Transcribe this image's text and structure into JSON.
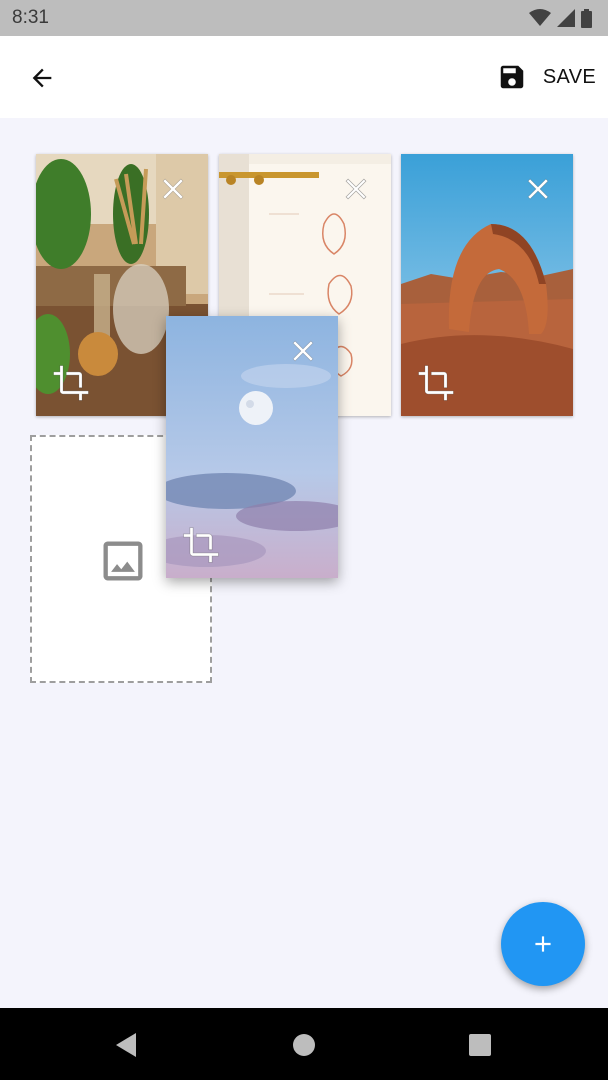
{
  "status_bar": {
    "time": "8:31",
    "icons": [
      "wifi-icon",
      "cell-signal-icon",
      "battery-icon"
    ]
  },
  "app_bar": {
    "back_icon": "arrow-back-icon",
    "save_icon": "floppy-disk-icon",
    "save_label": "SAVE"
  },
  "tiles": [
    {
      "name": "plants-photo",
      "close_icon": "close-icon",
      "crop_icon": "crop-icon"
    },
    {
      "name": "botanical-prints-photo",
      "close_icon": "close-icon"
    },
    {
      "name": "arch-rock-photo",
      "close_icon": "close-icon",
      "crop_icon": "crop-icon"
    },
    {
      "name": "moon-sky-photo",
      "close_icon": "close-icon",
      "crop_icon": "crop-icon",
      "state": "dragging"
    }
  ],
  "placeholder": {
    "icon": "image-icon"
  },
  "fab": {
    "icon": "plus-icon"
  },
  "nav_bar": {
    "buttons": [
      "back-triangle-icon",
      "home-circle-icon",
      "recents-square-icon"
    ]
  },
  "colors": {
    "status_bar": "#bdbdbd",
    "background": "#f4f4fc",
    "accent": "#2196f3",
    "nav_bar": "#000000"
  }
}
